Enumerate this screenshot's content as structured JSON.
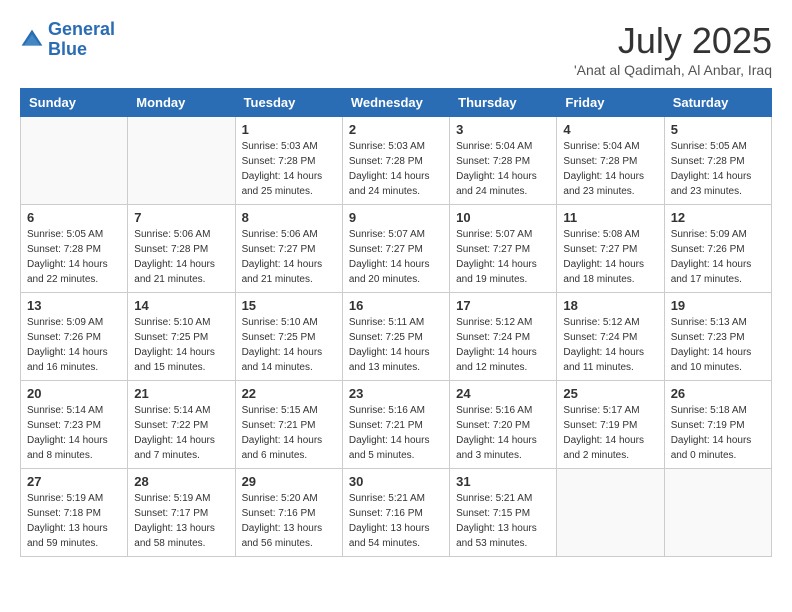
{
  "header": {
    "logo_line1": "General",
    "logo_line2": "Blue",
    "month": "July 2025",
    "location": "'Anat al Qadimah, Al Anbar, Iraq"
  },
  "weekdays": [
    "Sunday",
    "Monday",
    "Tuesday",
    "Wednesday",
    "Thursday",
    "Friday",
    "Saturday"
  ],
  "weeks": [
    [
      {
        "day": "",
        "info": ""
      },
      {
        "day": "",
        "info": ""
      },
      {
        "day": "1",
        "info": "Sunrise: 5:03 AM\nSunset: 7:28 PM\nDaylight: 14 hours and 25 minutes."
      },
      {
        "day": "2",
        "info": "Sunrise: 5:03 AM\nSunset: 7:28 PM\nDaylight: 14 hours and 24 minutes."
      },
      {
        "day": "3",
        "info": "Sunrise: 5:04 AM\nSunset: 7:28 PM\nDaylight: 14 hours and 24 minutes."
      },
      {
        "day": "4",
        "info": "Sunrise: 5:04 AM\nSunset: 7:28 PM\nDaylight: 14 hours and 23 minutes."
      },
      {
        "day": "5",
        "info": "Sunrise: 5:05 AM\nSunset: 7:28 PM\nDaylight: 14 hours and 23 minutes."
      }
    ],
    [
      {
        "day": "6",
        "info": "Sunrise: 5:05 AM\nSunset: 7:28 PM\nDaylight: 14 hours and 22 minutes."
      },
      {
        "day": "7",
        "info": "Sunrise: 5:06 AM\nSunset: 7:28 PM\nDaylight: 14 hours and 21 minutes."
      },
      {
        "day": "8",
        "info": "Sunrise: 5:06 AM\nSunset: 7:27 PM\nDaylight: 14 hours and 21 minutes."
      },
      {
        "day": "9",
        "info": "Sunrise: 5:07 AM\nSunset: 7:27 PM\nDaylight: 14 hours and 20 minutes."
      },
      {
        "day": "10",
        "info": "Sunrise: 5:07 AM\nSunset: 7:27 PM\nDaylight: 14 hours and 19 minutes."
      },
      {
        "day": "11",
        "info": "Sunrise: 5:08 AM\nSunset: 7:27 PM\nDaylight: 14 hours and 18 minutes."
      },
      {
        "day": "12",
        "info": "Sunrise: 5:09 AM\nSunset: 7:26 PM\nDaylight: 14 hours and 17 minutes."
      }
    ],
    [
      {
        "day": "13",
        "info": "Sunrise: 5:09 AM\nSunset: 7:26 PM\nDaylight: 14 hours and 16 minutes."
      },
      {
        "day": "14",
        "info": "Sunrise: 5:10 AM\nSunset: 7:25 PM\nDaylight: 14 hours and 15 minutes."
      },
      {
        "day": "15",
        "info": "Sunrise: 5:10 AM\nSunset: 7:25 PM\nDaylight: 14 hours and 14 minutes."
      },
      {
        "day": "16",
        "info": "Sunrise: 5:11 AM\nSunset: 7:25 PM\nDaylight: 14 hours and 13 minutes."
      },
      {
        "day": "17",
        "info": "Sunrise: 5:12 AM\nSunset: 7:24 PM\nDaylight: 14 hours and 12 minutes."
      },
      {
        "day": "18",
        "info": "Sunrise: 5:12 AM\nSunset: 7:24 PM\nDaylight: 14 hours and 11 minutes."
      },
      {
        "day": "19",
        "info": "Sunrise: 5:13 AM\nSunset: 7:23 PM\nDaylight: 14 hours and 10 minutes."
      }
    ],
    [
      {
        "day": "20",
        "info": "Sunrise: 5:14 AM\nSunset: 7:23 PM\nDaylight: 14 hours and 8 minutes."
      },
      {
        "day": "21",
        "info": "Sunrise: 5:14 AM\nSunset: 7:22 PM\nDaylight: 14 hours and 7 minutes."
      },
      {
        "day": "22",
        "info": "Sunrise: 5:15 AM\nSunset: 7:21 PM\nDaylight: 14 hours and 6 minutes."
      },
      {
        "day": "23",
        "info": "Sunrise: 5:16 AM\nSunset: 7:21 PM\nDaylight: 14 hours and 5 minutes."
      },
      {
        "day": "24",
        "info": "Sunrise: 5:16 AM\nSunset: 7:20 PM\nDaylight: 14 hours and 3 minutes."
      },
      {
        "day": "25",
        "info": "Sunrise: 5:17 AM\nSunset: 7:19 PM\nDaylight: 14 hours and 2 minutes."
      },
      {
        "day": "26",
        "info": "Sunrise: 5:18 AM\nSunset: 7:19 PM\nDaylight: 14 hours and 0 minutes."
      }
    ],
    [
      {
        "day": "27",
        "info": "Sunrise: 5:19 AM\nSunset: 7:18 PM\nDaylight: 13 hours and 59 minutes."
      },
      {
        "day": "28",
        "info": "Sunrise: 5:19 AM\nSunset: 7:17 PM\nDaylight: 13 hours and 58 minutes."
      },
      {
        "day": "29",
        "info": "Sunrise: 5:20 AM\nSunset: 7:16 PM\nDaylight: 13 hours and 56 minutes."
      },
      {
        "day": "30",
        "info": "Sunrise: 5:21 AM\nSunset: 7:16 PM\nDaylight: 13 hours and 54 minutes."
      },
      {
        "day": "31",
        "info": "Sunrise: 5:21 AM\nSunset: 7:15 PM\nDaylight: 13 hours and 53 minutes."
      },
      {
        "day": "",
        "info": ""
      },
      {
        "day": "",
        "info": ""
      }
    ]
  ]
}
